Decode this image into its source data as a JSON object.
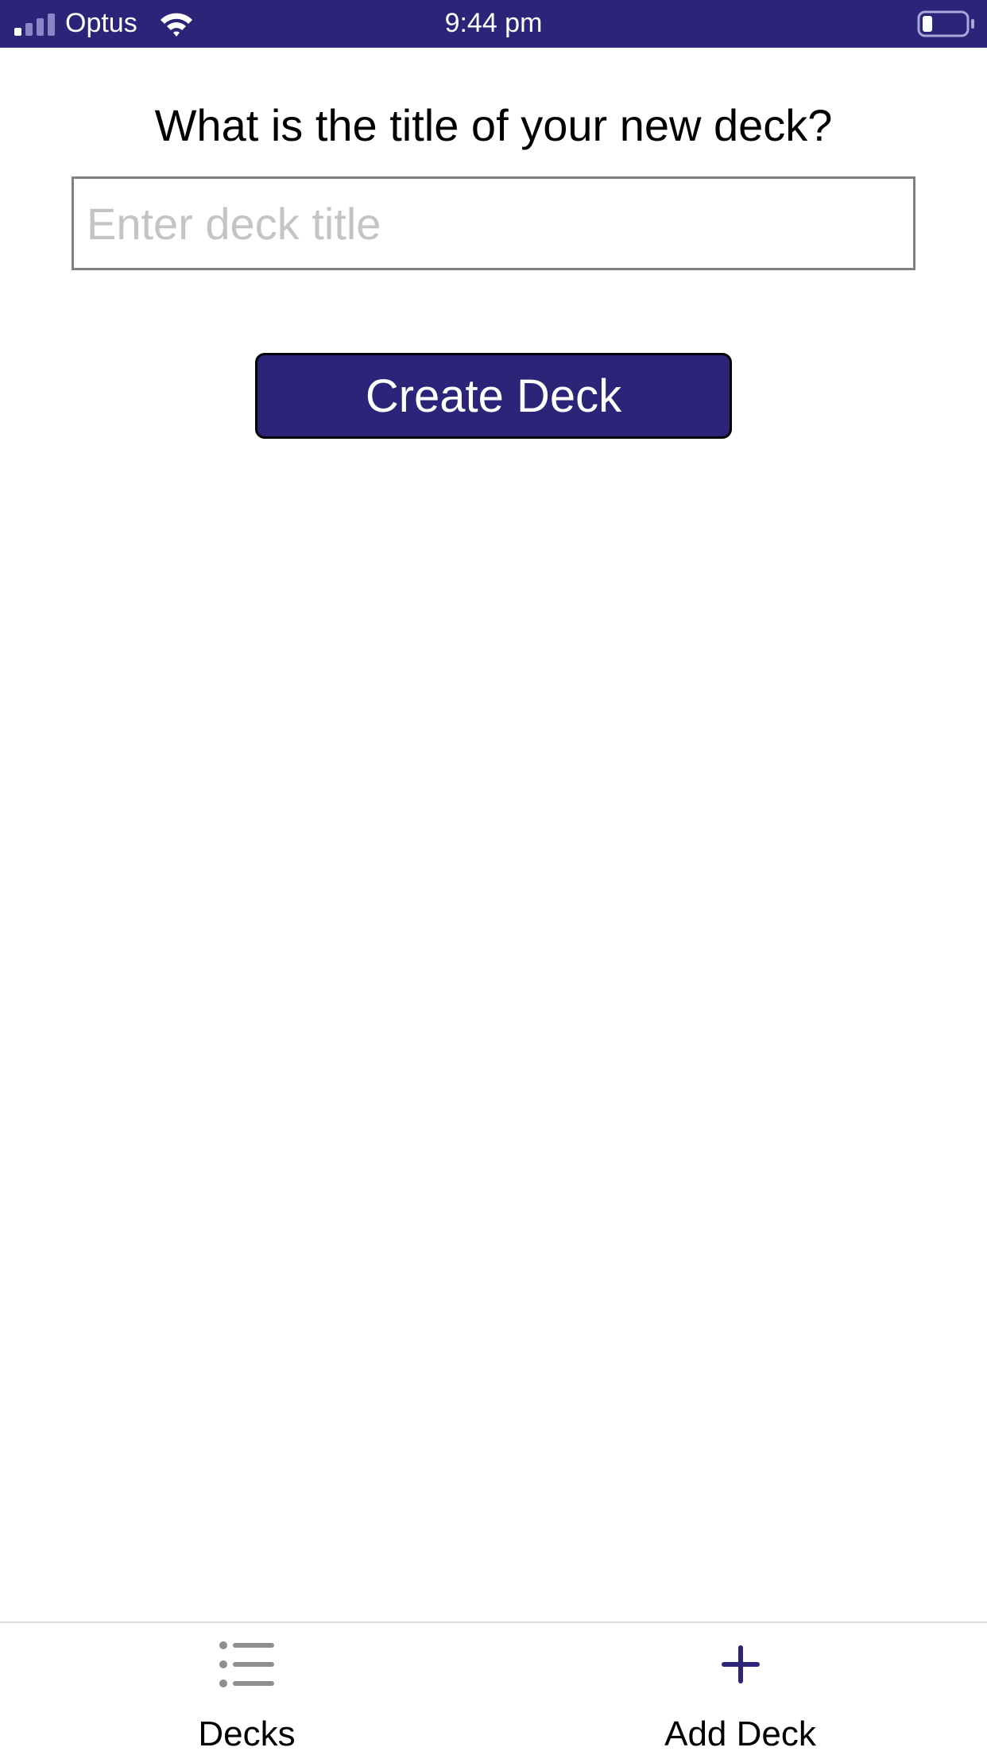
{
  "status_bar": {
    "carrier": "Optus",
    "time": "9:44 pm",
    "icons": [
      "signal-icon",
      "wifi-icon",
      "battery-icon"
    ],
    "background_color": "#2b2478"
  },
  "form": {
    "prompt": "What is the title of your new deck?",
    "title_input": {
      "value": "",
      "placeholder": "Enter deck title"
    },
    "create_button_label": "Create Deck",
    "button_color": "#2b2478"
  },
  "tab_bar": {
    "tabs": [
      {
        "label": "Decks",
        "icon": "list-icon",
        "active": false
      },
      {
        "label": "Add Deck",
        "icon": "plus-icon",
        "active": true
      }
    ],
    "active_color": "#2b2478",
    "inactive_color": "#8e8e93"
  }
}
